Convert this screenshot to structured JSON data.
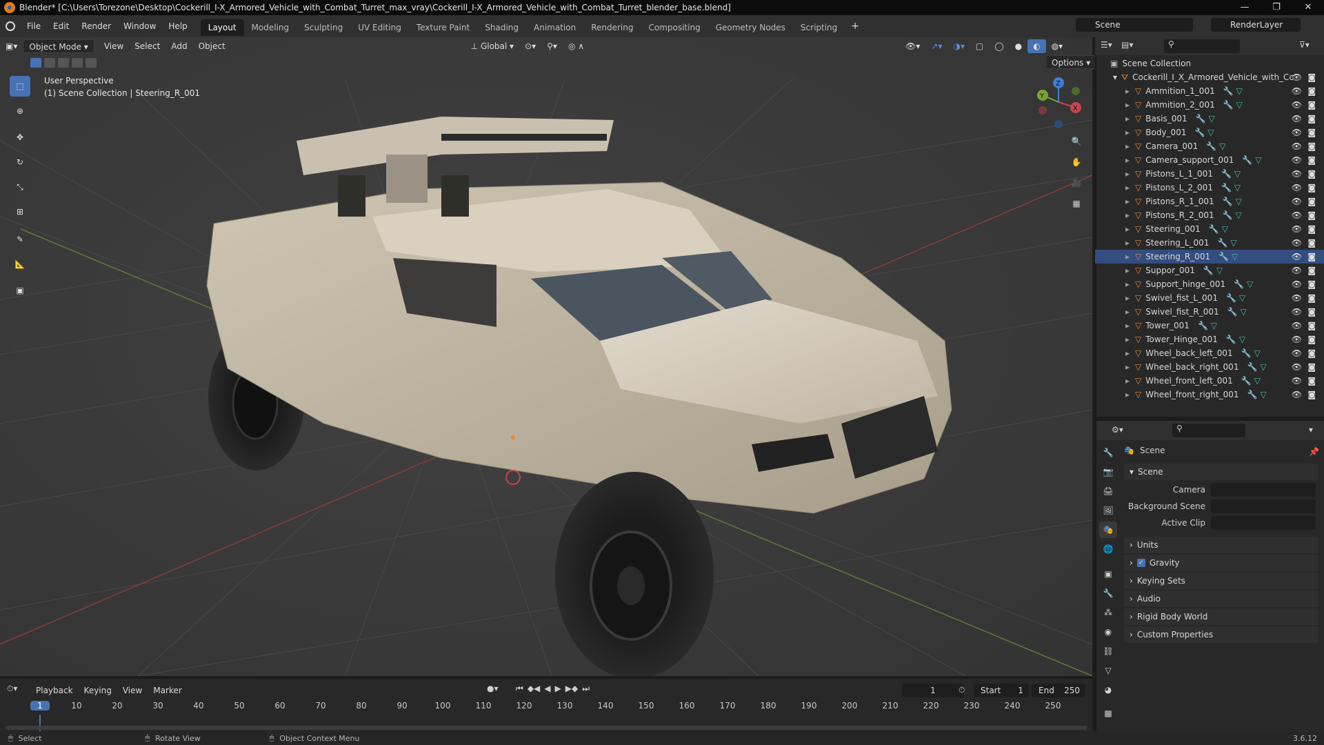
{
  "window": {
    "title": "Blender* [C:\\Users\\Torezone\\Desktop\\Cockerill_I-X_Armored_Vehicle_with_Combat_Turret_max_vray\\Cockerill_I-X_Armored_Vehicle_with_Combat_Turret_blender_base.blend]"
  },
  "menus": [
    "File",
    "Edit",
    "Render",
    "Window",
    "Help"
  ],
  "workspaces": [
    "Layout",
    "Modeling",
    "Sculpting",
    "UV Editing",
    "Texture Paint",
    "Shading",
    "Animation",
    "Rendering",
    "Compositing",
    "Geometry Nodes",
    "Scripting"
  ],
  "active_workspace": "Layout",
  "scene": {
    "name": "Scene",
    "view_layer": "RenderLayer"
  },
  "viewport": {
    "mode": "Object Mode",
    "menus": [
      "View",
      "Select",
      "Add",
      "Object"
    ],
    "orientation": "Global",
    "options": "Options",
    "overlay_title": "User Perspective",
    "overlay_subtitle": "(1) Scene Collection | Steering_R_001",
    "axes": {
      "x": "X",
      "y": "Y",
      "z": "Z"
    }
  },
  "outliner": {
    "root": "Scene Collection",
    "collection": "Cockerill_I_X_Armored_Vehicle_with_Cc",
    "objects": [
      "Ammition_1_001",
      "Ammition_2_001",
      "Basis_001",
      "Body_001",
      "Camera_001",
      "Camera_support_001",
      "Pistons_L_1_001",
      "Pistons_L_2_001",
      "Pistons_R_1_001",
      "Pistons_R_2_001",
      "Steering_001",
      "Steering_L_001",
      "Steering_R_001",
      "Suppor_001",
      "Support_hinge_001",
      "Swivel_fist_L_001",
      "Swivel_fist_R_001",
      "Tower_001",
      "Tower_Hinge_001",
      "Wheel_back_left_001",
      "Wheel_back_right_001",
      "Wheel_front_left_001",
      "Wheel_front_right_001"
    ],
    "selected": "Steering_R_001"
  },
  "properties": {
    "context_title": "Scene",
    "panel_title": "Scene",
    "fields": [
      {
        "label": "Camera"
      },
      {
        "label": "Background Scene"
      },
      {
        "label": "Active Clip"
      }
    ],
    "sections": [
      "Units",
      "Gravity",
      "Keying Sets",
      "Audio",
      "Rigid Body World",
      "Custom Properties"
    ],
    "gravity_checked": true
  },
  "timeline": {
    "menus": [
      "Playback",
      "Keying",
      "View",
      "Marker"
    ],
    "current_frame": "1",
    "start_label": "Start",
    "start": "1",
    "end_label": "End",
    "end": "250",
    "ticks": [
      "1",
      "10",
      "20",
      "30",
      "40",
      "50",
      "60",
      "70",
      "80",
      "90",
      "100",
      "110",
      "120",
      "130",
      "140",
      "150",
      "160",
      "170",
      "180",
      "190",
      "200",
      "210",
      "220",
      "230",
      "240",
      "250"
    ]
  },
  "status": {
    "select": "Select",
    "rotate": "Rotate View",
    "context": "Object Context Menu",
    "version": "3.6.12"
  },
  "colors": {
    "accent": "#4772b3",
    "object_icon": "#e8883b",
    "mesh_icon": "#3fbfa0",
    "modifier_icon": "#5aa5e8",
    "axis_x": "#c84650",
    "axis_y": "#7aa638",
    "axis_z": "#3d7fd6"
  }
}
